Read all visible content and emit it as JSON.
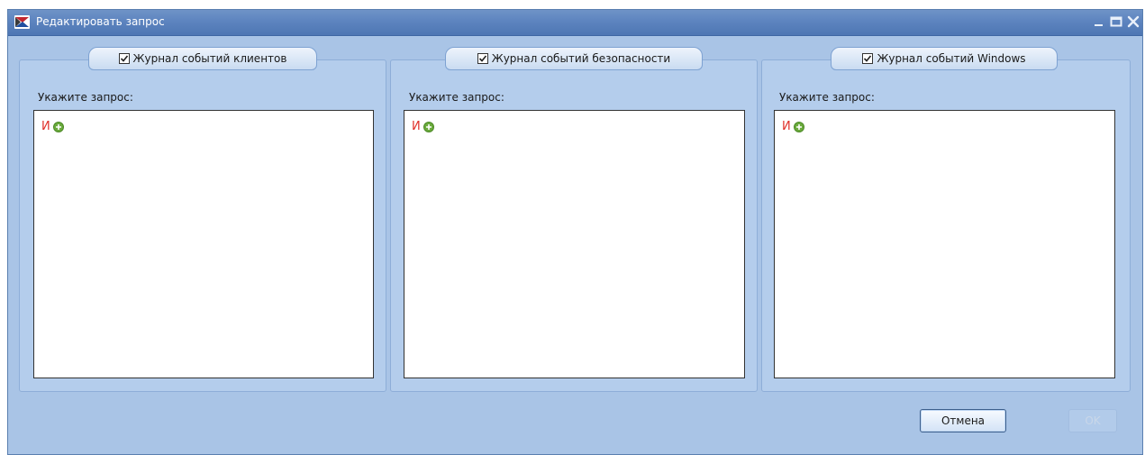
{
  "window": {
    "title": "Редактировать запрос",
    "icon": "app-logo-icon",
    "controls": [
      "minimize-icon",
      "maximize-icon",
      "close-icon"
    ]
  },
  "panels": [
    {
      "tab_label": "Журнал событий клиентов",
      "checked": true,
      "prompt_label": "Укажите запрос:",
      "query_operator": "И",
      "add_icon": "add-condition-icon"
    },
    {
      "tab_label": "Журнал событий безопасности",
      "checked": true,
      "prompt_label": "Укажите запрос:",
      "query_operator": "И",
      "add_icon": "add-condition-icon"
    },
    {
      "tab_label": "Журнал событий Windows",
      "checked": true,
      "prompt_label": "Укажите запрос:",
      "query_operator": "И",
      "add_icon": "add-condition-icon"
    }
  ],
  "buttons": {
    "cancel_label": "Отмена",
    "ok_label": "OK",
    "ok_enabled": false
  },
  "colors": {
    "window_background": "#a9c4e6",
    "titlebar": "#5d84bf",
    "operator_red": "#e0302a",
    "add_green": "#6aaa3c"
  }
}
